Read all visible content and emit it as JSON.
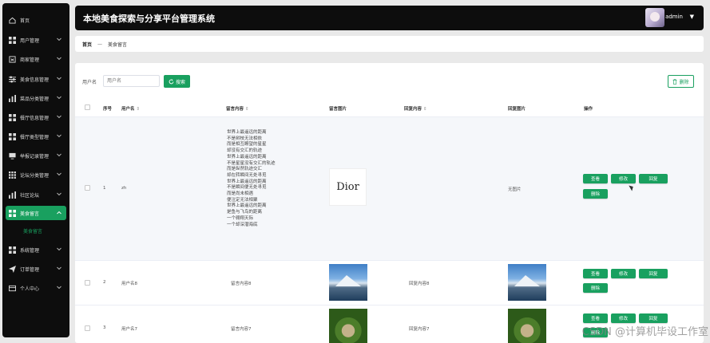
{
  "app": {
    "title": "本地美食探索与分享平台管理系统",
    "user": "admin"
  },
  "sidebar": {
    "items": [
      {
        "label": "首页",
        "icon": "home-icon"
      },
      {
        "label": "用户管理",
        "icon": "grid-icon"
      },
      {
        "label": "商家管理",
        "icon": "store-icon"
      },
      {
        "label": "美食信息管理",
        "icon": "sliders-icon"
      },
      {
        "label": "菜品分类管理",
        "icon": "chart-icon"
      },
      {
        "label": "餐厅信息管理",
        "icon": "grid-icon"
      },
      {
        "label": "餐厅类型管理",
        "icon": "grid-icon"
      },
      {
        "label": "举报记录管理",
        "icon": "monitor-icon"
      },
      {
        "label": "论坛分类管理",
        "icon": "apps-icon"
      },
      {
        "label": "社区论坛",
        "icon": "chart-icon"
      },
      {
        "label": "美食留言",
        "icon": "grid-icon"
      },
      {
        "label": "系统管理",
        "icon": "grid-icon"
      },
      {
        "label": "订单管理",
        "icon": "send-icon"
      },
      {
        "label": "个人中心",
        "icon": "card-icon"
      }
    ],
    "sub_item": "美食留言"
  },
  "breadcrumb": {
    "home": "首页",
    "sep": "—",
    "current": "美食留言"
  },
  "search": {
    "label": "用户名",
    "placeholder": "用户名",
    "button": "搜索",
    "delete_button": "删除"
  },
  "table": {
    "headers": {
      "index": "序号",
      "username": "用户名",
      "content": "留言内容",
      "image": "留言图片",
      "reply": "回复内容",
      "reply_image": "回复图片",
      "actions": "操作"
    },
    "rows": [
      {
        "index": "1",
        "username": "zh",
        "content_lines": [
          "世界上最遥远的距离",
          "不是树枝无法相依",
          "而是相互瞭望的星星",
          "却没有交汇的轨迹",
          "世界上最遥远的距离",
          "不是星星没有交汇的轨迹",
          "而是纵然轨迹交汇",
          "却在转瞬间无处寻觅",
          "世界上最遥远的距离",
          "不是瞬间便无处寻觅",
          "而是尚未相遇",
          "便注定无法相聚",
          "世界上最遥远的距离",
          "是鱼与飞鸟的距离",
          "一个翱翔天际",
          "一个却深潜海底"
        ],
        "image_text": "Dior",
        "reply": "",
        "reply_image": "无图片"
      },
      {
        "index": "2",
        "username": "用户名8",
        "content": "留言内容8",
        "reply": "回复内容8"
      },
      {
        "index": "3",
        "username": "用户名7",
        "content": "留言内容7",
        "reply": "回复内容7"
      }
    ],
    "actions": {
      "view": "查看",
      "edit": "修改",
      "reply": "回复",
      "delete": "删除"
    }
  },
  "watermark": "CSDN @计算机毕设工作室"
}
